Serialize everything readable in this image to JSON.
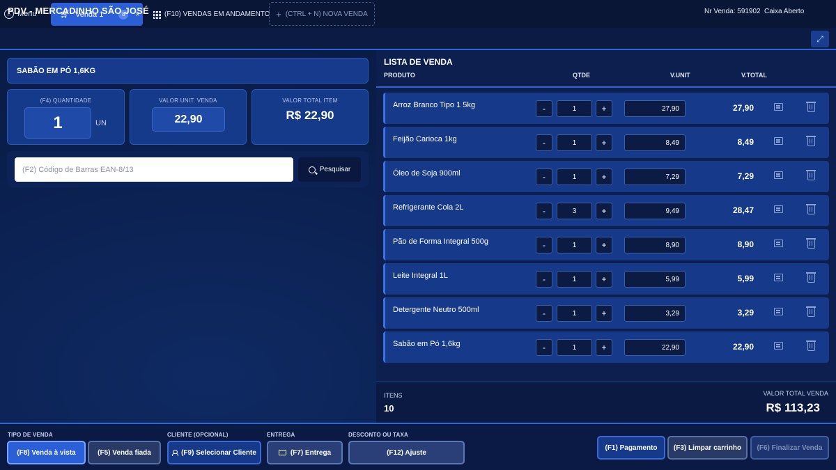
{
  "topbar": {
    "menu_label": "Menu",
    "active_tab": {
      "label": "Venda 1",
      "badge": "8"
    },
    "progress_tab_label": "(F10) VENDAS EM ANDAMENTO",
    "new_tab_label": "(CTRL + N) NOVA VENDA"
  },
  "header": {
    "store_name": "PDV - MERCADINHO SÃO JOSÉ",
    "nr_venda": "Nr Venda: 591902",
    "caixa_status": "Caixa Aberto"
  },
  "current_item": {
    "title": "SABÃO EM PÓ 1,6KG",
    "qty_label": "(F4) QUANTIDADE",
    "qty_value": "1",
    "unit": "UN",
    "unit_price_label": "VALOR UNIT. VENDA",
    "unit_price": "22,90",
    "total_label": "VALOR TOTAL ITEM",
    "total_value": "R$ 22,90"
  },
  "search": {
    "placeholder": "(F2) Código de Barras EAN-8/13",
    "button_label": "Pesquisar"
  },
  "list": {
    "title": "LISTA DE VENDA",
    "columns": {
      "produto": "PRODUTO",
      "qtde": "QTDE",
      "vunit": "V.UNIT",
      "vtotal": "V.TOTAL"
    },
    "minus_label": "-",
    "plus_label": "+",
    "items": [
      {
        "name": "Arroz Branco Tipo 1 5kg",
        "qty": "1",
        "unit": "27,90",
        "total": "27,90"
      },
      {
        "name": "Feijão Carioca 1kg",
        "qty": "1",
        "unit": "8,49",
        "total": "8,49"
      },
      {
        "name": "Óleo de Soja 900ml",
        "qty": "1",
        "unit": "7,29",
        "total": "7,29"
      },
      {
        "name": "Refrigerante Cola 2L",
        "qty": "3",
        "unit": "9,49",
        "total": "28,47"
      },
      {
        "name": "Pão de Forma Integral 500g",
        "qty": "1",
        "unit": "8,90",
        "total": "8,90"
      },
      {
        "name": "Leite Integral 1L",
        "qty": "1",
        "unit": "5,99",
        "total": "5,99"
      },
      {
        "name": "Detergente Neutro 500ml",
        "qty": "1",
        "unit": "3,29",
        "total": "3,29"
      },
      {
        "name": "Sabão em Pó 1,6kg",
        "qty": "1",
        "unit": "22,90",
        "total": "22,90"
      }
    ],
    "itens_label": "ITENS",
    "itens_count": "10",
    "total_label": "VALOR TOTAL VENDA",
    "total_value": "R$ 113,23"
  },
  "bottom": {
    "tipo_label": "TIPO DE VENDA",
    "vista_btn": "(F8) Venda à vista",
    "fiada_btn": "(F5) Venda fiada",
    "cliente_label": "CLIENTE (OPCIONAL)",
    "cliente_btn": "(F9) Selecionar Cliente",
    "entrega_label": "ENTREGA",
    "entrega_btn": "(F7) Entrega",
    "desconto_label": "DESCONTO OU TAXA",
    "ajuste_btn": "(F12) Ajuste",
    "pagamento_btn": "(F1) Pagamento",
    "limpar_btn": "(F3) Limpar carrinho",
    "finalizar_btn": "(F6) Finalizar Venda"
  }
}
